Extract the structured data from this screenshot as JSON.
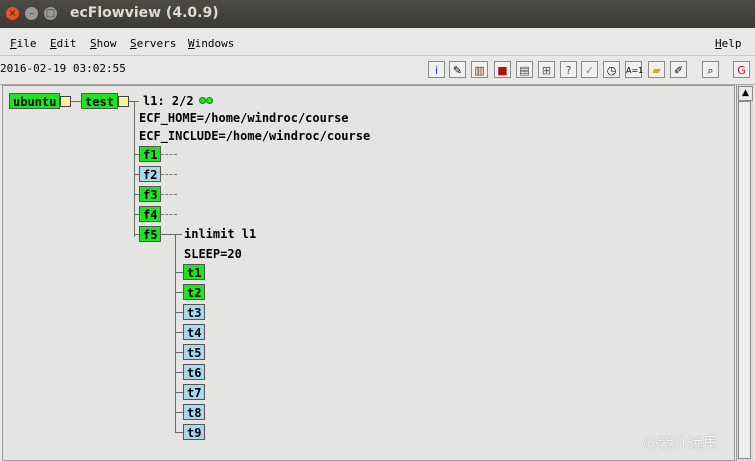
{
  "window": {
    "title": "ecFlowview (4.0.9)",
    "close_glyph": "×",
    "min_glyph": "–",
    "max_glyph": "□"
  },
  "menu": {
    "file": {
      "u": "F",
      "rest": "ile"
    },
    "edit": {
      "u": "E",
      "rest": "dit"
    },
    "show": {
      "u": "S",
      "rest": "how"
    },
    "servers": {
      "u": "S",
      "rest": "ervers"
    },
    "windows": {
      "u": "W",
      "rest": "indows"
    },
    "help": {
      "u": "H",
      "rest": "elp"
    }
  },
  "toolbar": {
    "datetime": "2016-02-19 03:02:55",
    "icons": [
      {
        "name": "info-icon",
        "glyph": "i",
        "color": "#1a3fb0"
      },
      {
        "name": "script-icon",
        "glyph": "✎",
        "color": "#000000"
      },
      {
        "name": "books-icon",
        "glyph": "▥",
        "color": "#6a3a10"
      },
      {
        "name": "variables-icon",
        "glyph": "■",
        "color": "#b01010"
      },
      {
        "name": "output-icon",
        "glyph": "▤",
        "color": "#444444"
      },
      {
        "name": "tree-icon",
        "glyph": "⊞",
        "color": "#555555"
      },
      {
        "name": "why-icon",
        "glyph": "?",
        "color": "#555555"
      },
      {
        "name": "check-icon",
        "glyph": "✓",
        "color": "#888888"
      },
      {
        "name": "clock-icon",
        "glyph": "◷",
        "color": "#000000"
      },
      {
        "name": "equals-icon",
        "glyph": "A=1",
        "color": "#000000"
      },
      {
        "name": "note-icon",
        "glyph": "▰",
        "color": "#c8b400"
      },
      {
        "name": "edit-icon",
        "glyph": "✐",
        "color": "#000000"
      },
      {
        "name": "search-icon",
        "glyph": "⌕",
        "color": "#000000"
      },
      {
        "name": "refresh-icon",
        "glyph": "G",
        "color": "#d01010"
      }
    ]
  },
  "tree": {
    "server": "ubuntu",
    "suite": "test",
    "limit": "l1: 2/2",
    "var1": "ECF_HOME=/home/windroc/course",
    "var2": "ECF_INCLUDE=/home/windroc/course",
    "families": [
      {
        "name": "f1",
        "status": "green"
      },
      {
        "name": "f2",
        "status": "blue"
      },
      {
        "name": "f3",
        "status": "green"
      },
      {
        "name": "f4",
        "status": "green"
      },
      {
        "name": "f5",
        "status": "green"
      }
    ],
    "inlimit": "inlimit l1",
    "sleep": "SLEEP=20",
    "tasks": [
      {
        "name": "t1",
        "status": "green"
      },
      {
        "name": "t2",
        "status": "green"
      },
      {
        "name": "t3",
        "status": "blue"
      },
      {
        "name": "t4",
        "status": "blue"
      },
      {
        "name": "t5",
        "status": "blue"
      },
      {
        "name": "t6",
        "status": "blue"
      },
      {
        "name": "t7",
        "status": "blue"
      },
      {
        "name": "t8",
        "status": "blue"
      },
      {
        "name": "t9",
        "status": "blue"
      }
    ]
  },
  "scrollbar": {
    "up_glyph": "▲"
  },
  "watermark": "@紫升远思"
}
